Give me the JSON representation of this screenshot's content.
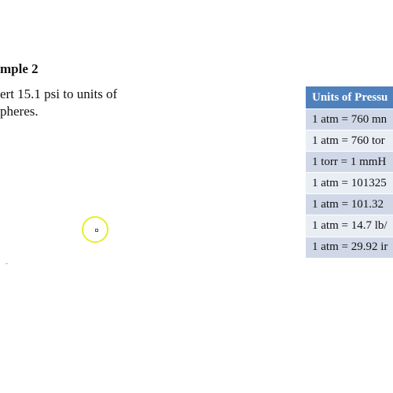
{
  "slide": {
    "title": "mple 2",
    "body_lines": [
      "ert 15.1 psi to units of",
      "pheres."
    ]
  },
  "table": {
    "header": "Units of Pressu",
    "rows": [
      "1 atm = 760 mn",
      "1 atm = 760 tor",
      "1 torr = 1 mmH",
      "1 atm = 101325",
      "1 atm = 101.32",
      "1 atm = 14.7 lb/",
      "1 atm = 29.92 ir"
    ],
    "colors": {
      "header_bg": "#4f81bd",
      "row_dark": "#d0d8e8",
      "row_light": "#e9edf4"
    }
  },
  "pointer": {
    "icon": "cursor-highlight-icon",
    "ring_color": "#e6ee2a"
  }
}
